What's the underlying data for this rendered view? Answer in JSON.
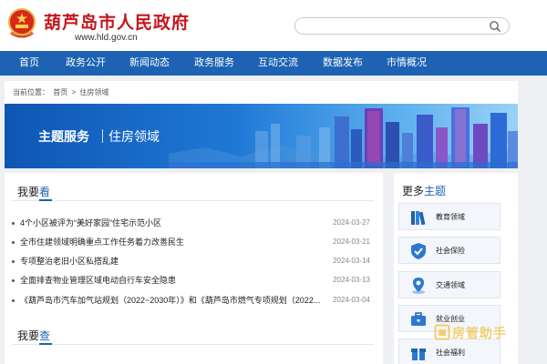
{
  "header": {
    "title": "葫芦岛市人民政府",
    "url": "www.hld.gov.cn",
    "search_placeholder": ""
  },
  "nav": {
    "items": [
      "首页",
      "政务公开",
      "新闻动态",
      "政务服务",
      "互动交流",
      "数据发布",
      "市情概况"
    ]
  },
  "breadcrumb": {
    "label": "当前位置：",
    "home": "首页",
    "sep": ">",
    "current": "住房领域"
  },
  "banner": {
    "title": "主题服务",
    "subtitle": "住房领域"
  },
  "see": {
    "title_a": "我要",
    "title_b": "看",
    "items": [
      {
        "title": "4个小区被评为“美好家园”住宅示范小区",
        "date": "2024-03-27"
      },
      {
        "title": "全市住建领域明确重点工作任务着力改善民生",
        "date": "2024-03-21"
      },
      {
        "title": "专项整治老旧小区私搭乱建",
        "date": "2024-03-14"
      },
      {
        "title": "全面排查物业管理区域电动自行车安全隐患",
        "date": "2024-03-13"
      },
      {
        "title": "《葫芦岛市汽车加气站规划（2022~2030年）》和《葫芦岛市燃气专项规划（2022...",
        "date": "2024-03-04"
      }
    ]
  },
  "query": {
    "title_a": "我要",
    "title_b": "查"
  },
  "side": {
    "title_a": "更多",
    "title_b": "主题",
    "items": [
      {
        "label": "教育领域",
        "icon": "books-icon"
      },
      {
        "label": "社会保险",
        "icon": "shield-check-icon"
      },
      {
        "label": "交通领域",
        "icon": "location-pin-icon"
      },
      {
        "label": "就业创业",
        "icon": "briefcase-icon"
      },
      {
        "label": "社会福利",
        "icon": "gift-icon"
      }
    ]
  },
  "watermark": {
    "text": "房管助手"
  },
  "colors": {
    "brand_red": "#c4161c",
    "nav_blue": "#1d62b3",
    "accent_gold": "#f2cf73"
  }
}
